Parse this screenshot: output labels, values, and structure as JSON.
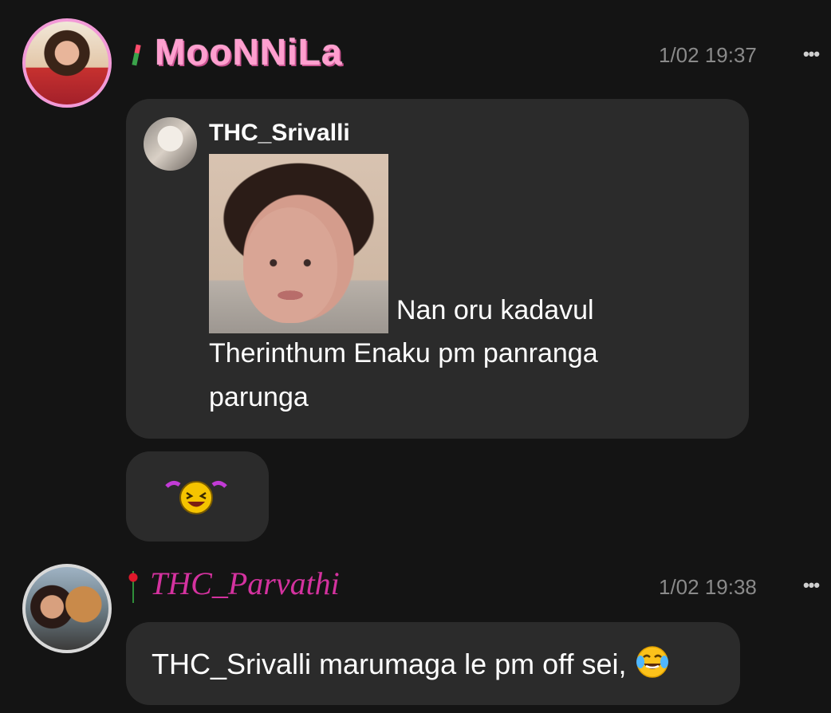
{
  "messages": [
    {
      "sender": "MooNNiLa",
      "timestamp": "1/02 19:37",
      "quoted": {
        "author": "THC_Srivalli",
        "text_line1": "Nan oru kadavul",
        "text_line2": "Therinthum Enaku pm panranga",
        "text_line3": "parunga"
      },
      "sticker": "laughing-emoji-icon"
    },
    {
      "sender": "THC_Parvathi",
      "timestamp": "1/02 19:38",
      "text": "THC_Srivalli marumaga le pm off sei,",
      "emoji": "face-with-tears-of-joy-icon"
    }
  ],
  "icons": {
    "more": "more-options-icon",
    "tulip": "tulip-icon",
    "rose": "rose-icon"
  },
  "colors": {
    "background": "#141414",
    "bubble": "#2b2b2b",
    "moonnila_name": "#ff9fcf",
    "parvathi_name": "#d4329f",
    "timestamp": "#8a8a8a"
  }
}
